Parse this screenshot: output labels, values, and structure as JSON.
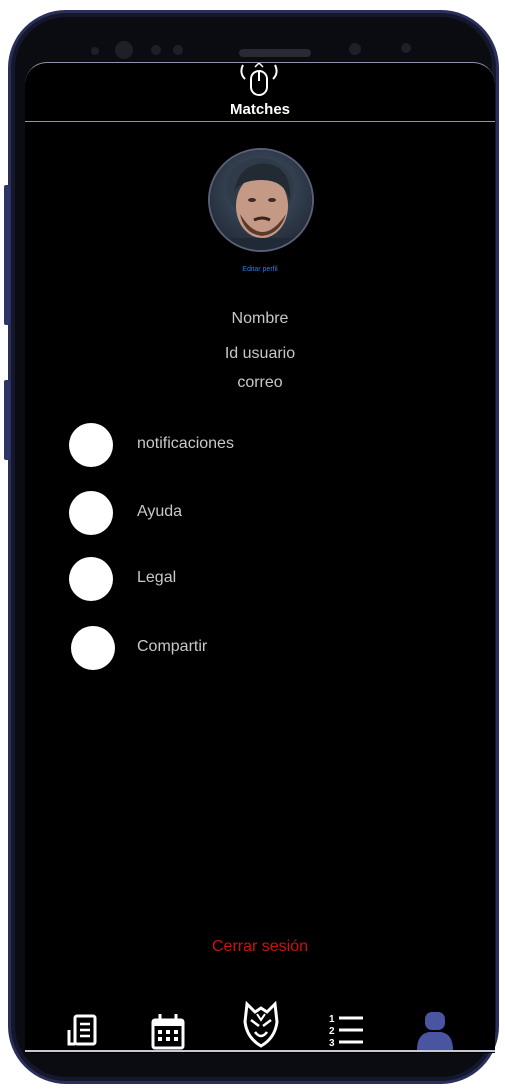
{
  "header": {
    "title": "Matches",
    "logo_icon": "mouse-logo-icon"
  },
  "profile": {
    "avatar": "user-avatar-photo",
    "edit_label": "Editar perfil",
    "name": "Nombre",
    "user_id": "Id usuario",
    "email": "correo"
  },
  "menu": {
    "items": [
      {
        "label": "notificaciones",
        "icon": "circle-icon"
      },
      {
        "label": "Ayuda",
        "icon": "circle-icon"
      },
      {
        "label": "Legal",
        "icon": "circle-icon"
      },
      {
        "label": "Compartir",
        "icon": "circle-icon"
      }
    ]
  },
  "logout_label": "Cerrar sesión",
  "bottom_nav": {
    "items": [
      {
        "icon": "news-icon",
        "active": false
      },
      {
        "icon": "calendar-icon",
        "active": false
      },
      {
        "icon": "team-logo-icon",
        "active": false
      },
      {
        "icon": "ranking-list-icon",
        "active": false
      },
      {
        "icon": "profile-icon",
        "active": true
      }
    ]
  },
  "colors": {
    "background": "#000000",
    "text": "#c8c8c8",
    "link": "#2d7dd8",
    "logout": "#cc1111",
    "nav_active": "#4a55a2",
    "device_frame": "#2a2f5a"
  }
}
